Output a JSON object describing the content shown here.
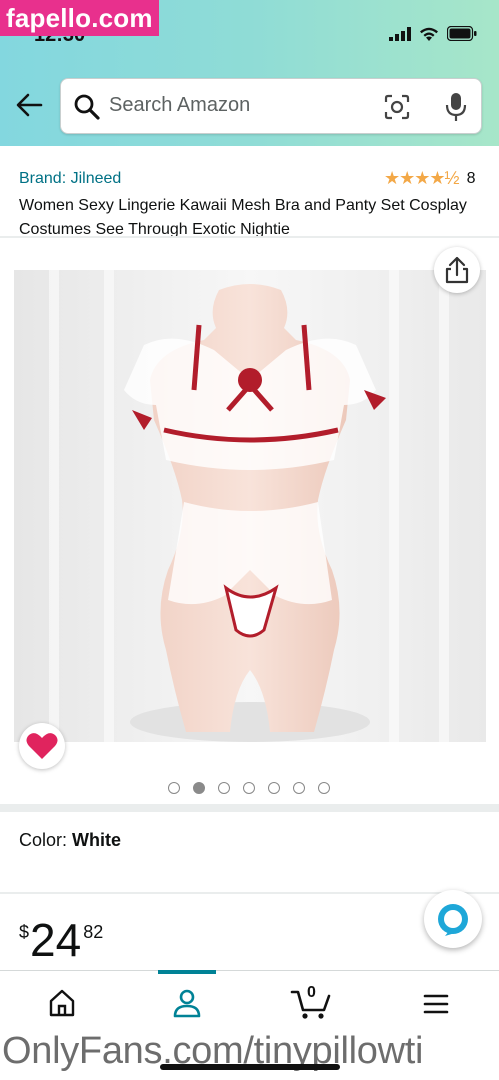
{
  "status_bar": {
    "time": "12:30"
  },
  "watermarks": {
    "top": "fapello.com",
    "bottom": "OnlyFans.com/tinypillowti"
  },
  "search": {
    "placeholder": "Search Amazon"
  },
  "product": {
    "brand": "Brand: Jilneed",
    "rating_stars": "★★★★½",
    "rating_value": 4.5,
    "rating_count": "8",
    "title": "Women Sexy Lingerie Kawaii Mesh Bra and Panty Set Cosplay Costumes See Through Exotic Nightie",
    "image_count": 7,
    "active_image_index": 1,
    "color_label": "Color:",
    "color_value": "White",
    "price_symbol": "$",
    "price_whole": "24",
    "price_fraction": "82"
  },
  "colors": {
    "header_gradient_start": "#83d7df",
    "header_gradient_end": "#a7e6c9",
    "brand_link": "#007185",
    "star": "#f3a847",
    "heart": "#e0245e",
    "nav_active": "#008296",
    "alexa": "#1ea7d8"
  },
  "nav": {
    "items": [
      {
        "name": "home",
        "icon": "home-icon"
      },
      {
        "name": "account",
        "icon": "person-icon",
        "active": true
      },
      {
        "name": "cart",
        "icon": "cart-icon",
        "badge": "0"
      },
      {
        "name": "menu",
        "icon": "hamburger-icon"
      }
    ]
  }
}
